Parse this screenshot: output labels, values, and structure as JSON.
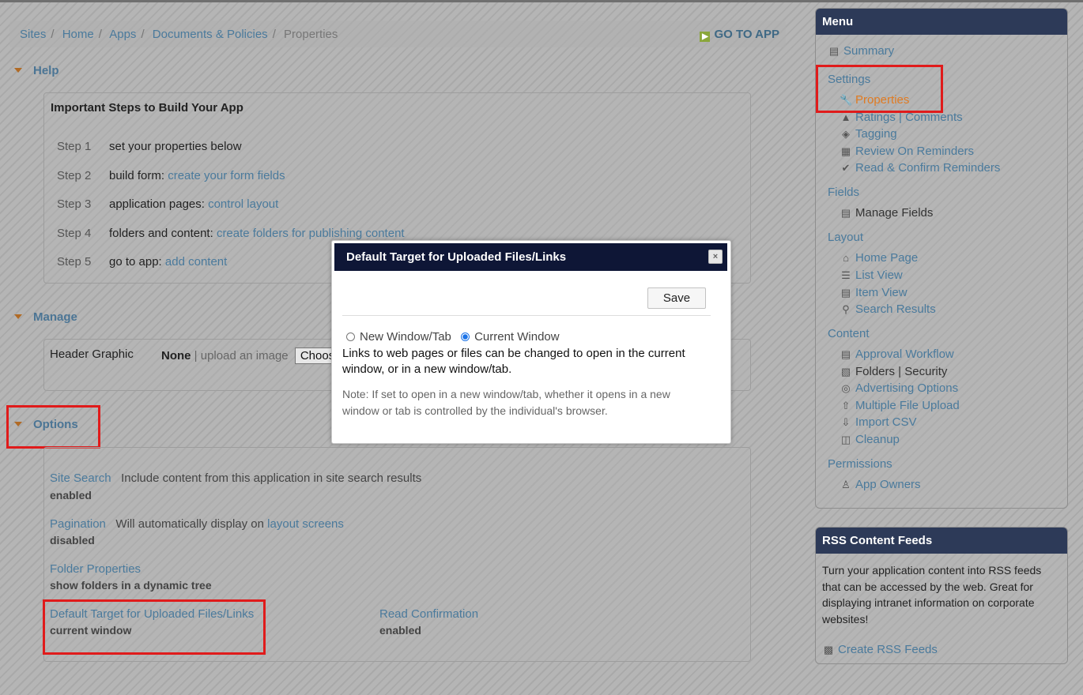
{
  "breadcrumb": {
    "items": [
      "Sites",
      "Home",
      "Apps",
      "Documents & Policies"
    ],
    "current": "Properties",
    "go_to_app": "GO TO APP"
  },
  "help": {
    "heading": "Help",
    "box_title": "Important Steps to Build Your App",
    "steps": [
      {
        "num": "Step 1",
        "text": "set your properties below",
        "link": ""
      },
      {
        "num": "Step 2",
        "text": "build form: ",
        "link": "create your form fields"
      },
      {
        "num": "Step 3",
        "text": "application pages: ",
        "link": "control layout"
      },
      {
        "num": "Step 4",
        "text": "folders and content: ",
        "link": "create folders for publishing content"
      },
      {
        "num": "Step 5",
        "text": "go to app: ",
        "link": "add content"
      }
    ]
  },
  "manage": {
    "heading": "Manage",
    "header_graphic_label": "Header Graphic",
    "header_graphic_value": "None",
    "upload_text": "| upload an image",
    "choose_button": "Choose"
  },
  "options": {
    "heading": "Options",
    "site_search": {
      "label": "Site Search",
      "desc": "Include content from this application in site search results",
      "value": "enabled"
    },
    "pagination": {
      "label": "Pagination",
      "desc": "Will automatically display on ",
      "link": "layout screens",
      "value": "disabled"
    },
    "folder_properties": {
      "label": "Folder Properties",
      "value": "show folders in a dynamic tree"
    },
    "default_target": {
      "label": "Default Target for Uploaded Files/Links",
      "value": "current window"
    },
    "read_confirmation": {
      "label": "Read Confirmation",
      "value": "enabled"
    }
  },
  "sidebar": {
    "menu_title": "Menu",
    "summary": "Summary",
    "settings": {
      "title": "Settings",
      "items": [
        "Properties",
        "Ratings | Comments",
        "Tagging",
        "Review On Reminders",
        "Read & Confirm Reminders"
      ]
    },
    "fields": {
      "title": "Fields",
      "items": [
        "Manage Fields"
      ]
    },
    "layout": {
      "title": "Layout",
      "items": [
        "Home Page",
        "List View",
        "Item View",
        "Search Results"
      ]
    },
    "content": {
      "title": "Content",
      "items": [
        "Approval Workflow",
        "Folders | Security",
        "Advertising Options",
        "Multiple File Upload",
        "Import CSV",
        "Cleanup"
      ]
    },
    "permissions": {
      "title": "Permissions",
      "items": [
        "App Owners"
      ]
    }
  },
  "rss": {
    "title": "RSS Content Feeds",
    "text": "Turn your application content into RSS feeds that can be accessed by the web. Great for displaying intranet information on corporate websites!",
    "link": "Create RSS Feeds"
  },
  "modal": {
    "title": "Default Target for Uploaded Files/Links",
    "close": "×",
    "save": "Save",
    "option_new": "New Window/Tab",
    "option_current": "Current Window",
    "selected": "Current Window",
    "text": "Links to web pages or files can be changed to open in the current window, or in a new window/tab.",
    "note": "Note: If set to open in a new window/tab, whether it opens in a new window or tab is controlled by the individual's browser."
  },
  "colors": {
    "accent": "#4a7a9c",
    "header_dark": "#0e1636",
    "active_orange": "#e07b22",
    "highlight_red": "#e01b1b"
  }
}
